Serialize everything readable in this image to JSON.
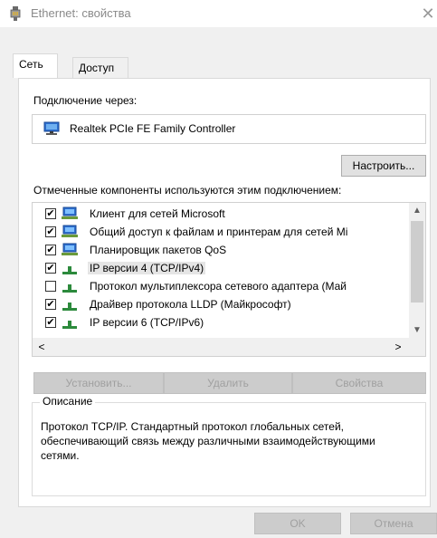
{
  "window": {
    "title": "Ethernet: свойства",
    "close_glyph": "✕"
  },
  "tabs": [
    {
      "label": "Сеть",
      "active": true
    },
    {
      "label": "Доступ",
      "active": false
    }
  ],
  "connection": {
    "label": "Подключение через:",
    "adapter_name": "Realtek PCIe FE Family Controller",
    "configure_button": "Настроить..."
  },
  "components": {
    "label": "Отмеченные компоненты используются этим подключением:",
    "items": [
      {
        "label": "Клиент для сетей Microsoft",
        "checked": true,
        "icon": "network-client-icon"
      },
      {
        "label": "Общий доступ к файлам и принтерам для сетей Mi",
        "checked": true,
        "icon": "network-client-icon"
      },
      {
        "label": "Планировщик пакетов QoS",
        "checked": true,
        "icon": "network-client-icon"
      },
      {
        "label": "IP версии 4 (TCP/IPv4)",
        "checked": true,
        "icon": "protocol-icon",
        "selected": true
      },
      {
        "label": "Протокол мультиплексора сетевого адаптера (Май",
        "checked": false,
        "icon": "protocol-icon"
      },
      {
        "label": "Драйвер протокола LLDP (Майкрософт)",
        "checked": true,
        "icon": "protocol-icon"
      },
      {
        "label": "IP версии 6 (TCP/IPv6)",
        "checked": true,
        "icon": "protocol-icon"
      }
    ],
    "install_button": "Установить...",
    "remove_button": "Удалить",
    "properties_button": "Свойства"
  },
  "description": {
    "legend": "Описание",
    "text": "Протокол TCP/IP. Стандартный протокол глобальных сетей, обеспечивающий связь между различными взаимодействующими сетями."
  },
  "footer": {
    "ok_button": "OK",
    "cancel_button": "Отмена"
  },
  "colors": {
    "window_bg": "#f0f0f0",
    "panel_bg": "#ffffff",
    "title_text": "#8a8a8a",
    "disabled_text": "#a0a0a0"
  }
}
